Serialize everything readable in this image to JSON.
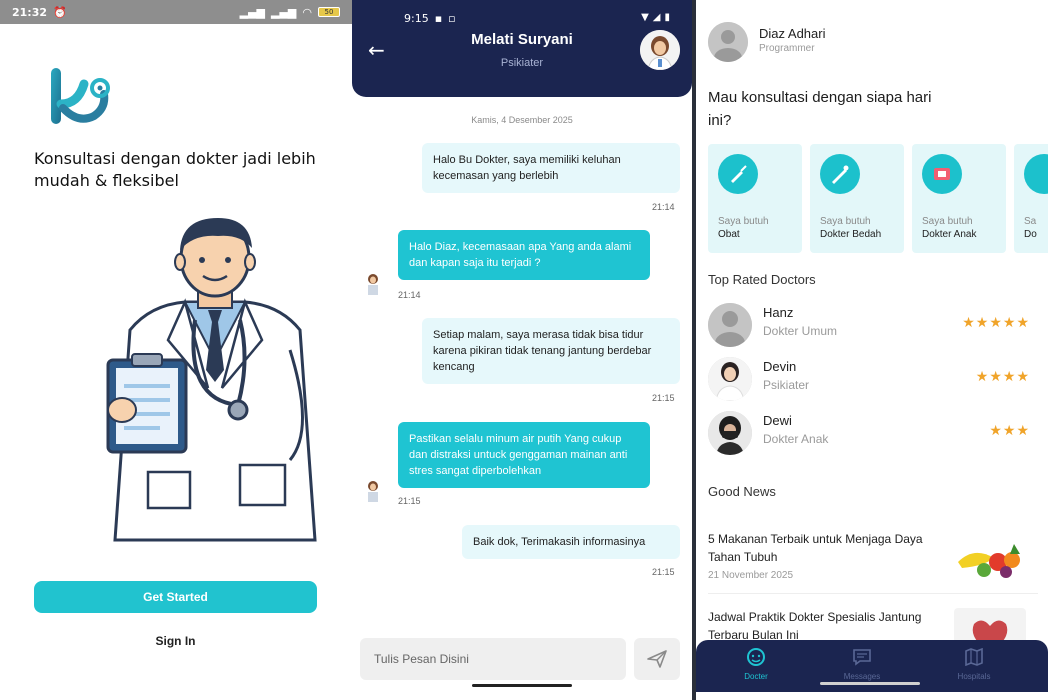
{
  "screen_welcome": {
    "status_time": "21:32",
    "battery": "50",
    "tagline": "Konsultasi dengan dokter jadi lebih mudah & fleksibel",
    "get_started": "Get Started",
    "sign_in": "Sign In"
  },
  "screen_chat": {
    "status_time": "9:15",
    "contact_name": "Melati Suryani",
    "contact_role": "Psikiater",
    "date_label": "Kamis, 4 Desember 2025",
    "messages": [
      {
        "text": "Halo Bu Dokter, saya memiliki keluhan kecemasan yang berlebih",
        "time": "21:14"
      },
      {
        "text": "Halo Diaz, kecemasaan apa Yang anda alami dan kapan saja itu terjadi ?",
        "time": "21:14"
      },
      {
        "text": "Setiap malam, saya merasa tidak bisa tidur karena pikiran tidak tenang jantung berdebar kencang",
        "time": "21:15"
      },
      {
        "text": "Pastikan selalu minum air putih Yang cukup dan distraksi untuck genggaman mainan anti stres sangat diperbolehkan",
        "time": "21:15"
      },
      {
        "text": "Baik dok, Terimakasih informasinya",
        "time": "21:15"
      }
    ],
    "input_placeholder": "Tulis Pesan Disini"
  },
  "screen_home": {
    "user_name": "Diaz Adhari",
    "user_role": "Programmer",
    "question": "Mau konsultasi dengan siapa hari ini?",
    "categories": [
      {
        "prefix": "Saya butuh",
        "label": "Obat"
      },
      {
        "prefix": "Saya butuh",
        "label": "Dokter Bedah"
      },
      {
        "prefix": "Saya butuh",
        "label": "Dokter Anak"
      },
      {
        "prefix": "Sa",
        "label": "Do"
      }
    ],
    "top_rated_title": "Top Rated Doctors",
    "doctors": [
      {
        "name": "Hanz",
        "specialty": "Dokter Umum",
        "rating": 5,
        "stars": "★★★★★"
      },
      {
        "name": "Devin",
        "specialty": "Psikiater",
        "rating": 4,
        "stars": "★★★★"
      },
      {
        "name": "Dewi",
        "specialty": "Dokter Anak",
        "rating": 3,
        "stars": "★★★"
      }
    ],
    "news_title": "Good News",
    "news": [
      {
        "title": "5 Makanan Terbaik untuk Menjaga Daya Tahan Tubuh",
        "date": "21 November 2025"
      },
      {
        "title": "Jadwal Praktik Dokter Spesialis Jantung Terbaru Bulan Ini",
        "date": ""
      }
    ],
    "nav": [
      {
        "label": "Docter",
        "icon": "doctor-face-icon"
      },
      {
        "label": "Messages",
        "icon": "chat-icon"
      },
      {
        "label": "Hospitals",
        "icon": "map-icon"
      }
    ]
  },
  "colors": {
    "accent": "#21c3cf",
    "navy": "#1b2550",
    "bubble_light": "#e6f8fb",
    "star": "#f0a42a"
  }
}
